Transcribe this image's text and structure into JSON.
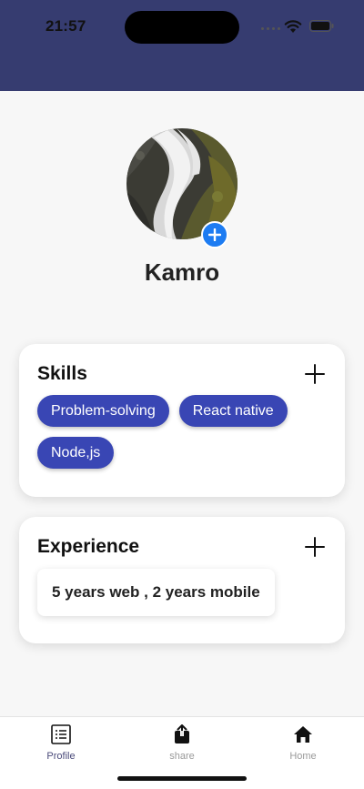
{
  "status_bar": {
    "time": "21:57"
  },
  "colors": {
    "header": "#363c70",
    "chip": "#3946b4",
    "avatar_add": "#1d7cf2"
  },
  "profile": {
    "name": "Kamro",
    "avatar_icon": "waterfall-photo",
    "add_icon": "plus-circle-icon"
  },
  "skills": {
    "title": "Skills",
    "add_icon": "plus-icon",
    "items": [
      "Problem-solving",
      "React native",
      "Node,js"
    ]
  },
  "experience": {
    "title": "Experience",
    "add_icon": "plus-icon",
    "value": "5 years web , 2 years mobile"
  },
  "tabbar": {
    "items": [
      {
        "label": "Profile",
        "icon": "list-icon",
        "active": true
      },
      {
        "label": "share",
        "icon": "share-icon",
        "active": false
      },
      {
        "label": "Home",
        "icon": "home-icon",
        "active": false
      }
    ]
  }
}
